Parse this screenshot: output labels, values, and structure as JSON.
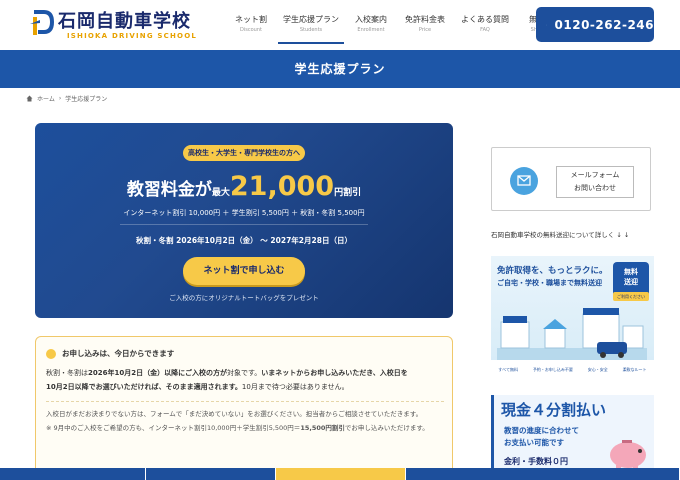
{
  "header": {
    "logo_title": "石岡自動車学校",
    "logo_sub": "ISHIOKA DRIVING SCHOOL",
    "nav": [
      {
        "label": "ネット割",
        "sub": "Discount"
      },
      {
        "label": "学生応援プラン",
        "sub": "Students"
      },
      {
        "label": "入校案内",
        "sub": "Enrollment"
      },
      {
        "label": "免許料金表",
        "sub": "Price"
      },
      {
        "label": "よくある質問",
        "sub": "FAQ"
      },
      {
        "label": "無料送迎",
        "sub": "Shuttle Bus"
      }
    ],
    "phone": "0120-262-246"
  },
  "page_title": "学生応援プラン",
  "breadcrumb": {
    "home": "ホーム",
    "current": "学生応援プラン"
  },
  "campaign": {
    "pill": "高校生・大学生・専門学校生の方へ",
    "headline_a": "教習料金が",
    "headline_b": "最大",
    "headline_amount": "21,000",
    "headline_d": "円割引",
    "breakdown": "インターネット割引 10,000円 ＋ 学生割引 5,500円 ＋ 秋割・冬割 5,500円",
    "period": "秋割・冬割 2026年10月2日（金） 〜 2027年2月28日（日）",
    "cta": "ネット割で申し込む",
    "gift": "ご入校の方にオリジナルトートバッグをプレゼント"
  },
  "notice": {
    "heading": "お申し込みは、今日からできます",
    "line1_a": "秋割・冬割は",
    "line1_b": "2026年10月2日（金）以降にご入校の方が",
    "line1_c": "対象です。",
    "line1_d": "いまネットからお申し込みいただき、入校日を",
    "line2_a": "10月2日以降でお選びいただければ、そのまま適用されます。",
    "line2_b": "10月まで待つ必要はありません。",
    "small1": "入校日がまだお決まりでない方は、フォームで「まだ決めていない」をお選びください。担当者からご相談させていただきます。",
    "small2_a": "※ 9月中のご入校をご希望の方も、インターネット割引10,000円＋学生割引5,500円＝",
    "small2_b": "15,500円割引",
    "small2_c": "でお申し込みいただけます。"
  },
  "sidebar": {
    "mail_line1": "メールフォーム",
    "mail_line2": "お問い合わせ",
    "shuttle_text": "石岡自動車学校の無料送迎について詳しく ↓ ↓",
    "banner1_title": "免許取得を、もっとラクに。",
    "banner1_sub": "ご自宅・学校・職場まで無料送迎",
    "banner1_badge_1": "無料",
    "banner1_badge_2": "送迎",
    "banner1_tag": "ご利用ください",
    "banner1_foot": [
      "すべて無料",
      "予約・お申し込み不要",
      "安心・安全",
      "柔軟なルート"
    ],
    "banner2_title": "現金４分割払い",
    "banner2_sub1": "教習の進度に合わせて",
    "banner2_sub2": "お支払い可能です",
    "banner2_fee": "金利・手数料０円"
  },
  "colors": {
    "primary": "#1d4f9c",
    "band": "#1d56a8",
    "accent": "#f7c948",
    "navy": "#1a2a6c"
  }
}
